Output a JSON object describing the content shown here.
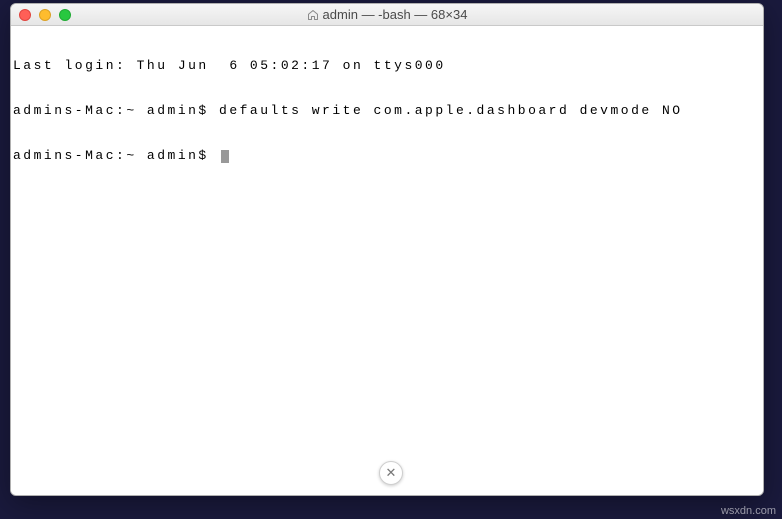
{
  "window": {
    "title": "admin — -bash — 68×34"
  },
  "terminal": {
    "lines": [
      "Last login: Thu Jun  6 05:02:17 on ttys000",
      "admins-Mac:~ admin$ defaults write com.apple.dashboard devmode NO",
      "admins-Mac:~ admin$ "
    ]
  },
  "close_bubble": {
    "glyph": "✕"
  },
  "watermark": "wsxdn.com"
}
